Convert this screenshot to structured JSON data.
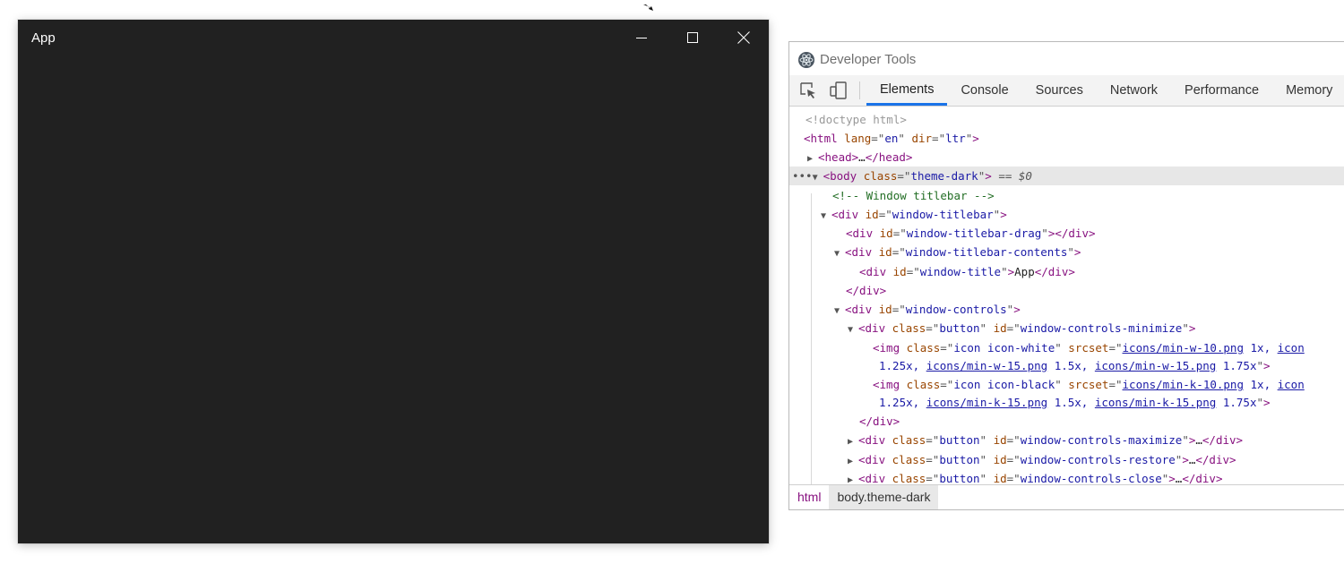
{
  "app": {
    "title": "App",
    "controls": {
      "minimize": "minimize",
      "maximize": "maximize",
      "close": "close"
    }
  },
  "devtools": {
    "title": "Developer Tools",
    "tabs": [
      "Elements",
      "Console",
      "Sources",
      "Network",
      "Performance",
      "Memory"
    ],
    "active_tab": "Elements",
    "dom": {
      "doctype": "<!doctype html>",
      "html_tag": "html",
      "lang": "en",
      "dir": "ltr",
      "head": "head",
      "body_class": "theme-dark",
      "sel_marker": "== $0",
      "comment": "<!-- Window titlebar -->",
      "ids": {
        "titlebar": "window-titlebar",
        "drag": "window-titlebar-drag",
        "contents": "window-titlebar-contents",
        "title": "window-title",
        "controls": "window-controls",
        "minimize": "window-controls-minimize",
        "maximize": "window-controls-maximize",
        "restore": "window-controls-restore",
        "close": "window-controls-close"
      },
      "title_text": "App",
      "button_class": "button",
      "icon_white_class": "icon icon-white",
      "icon_black_class": "icon icon-black",
      "white_src1": "icons/min-w-10.png",
      "white_src2": "icons/min-w-15.png",
      "white_src3": "icons/min-w-15.png",
      "black_src1": "icons/min-k-10.png",
      "black_src2": "icons/min-k-15.png",
      "black_src3": "icons/min-k-15.png",
      "x1": "1x,",
      "x125": "1.25x,",
      "x15": "1.5x,",
      "x175": "1.75x",
      "trunc_link": "icon"
    },
    "breadcrumb": [
      "html",
      "body.theme-dark"
    ]
  },
  "colors": {
    "app_bg": "#212121",
    "active_tab_underline": "#1a73e8",
    "tag": "#881280",
    "attr": "#994500",
    "value": "#1a1aa6",
    "comment": "#236e25"
  }
}
